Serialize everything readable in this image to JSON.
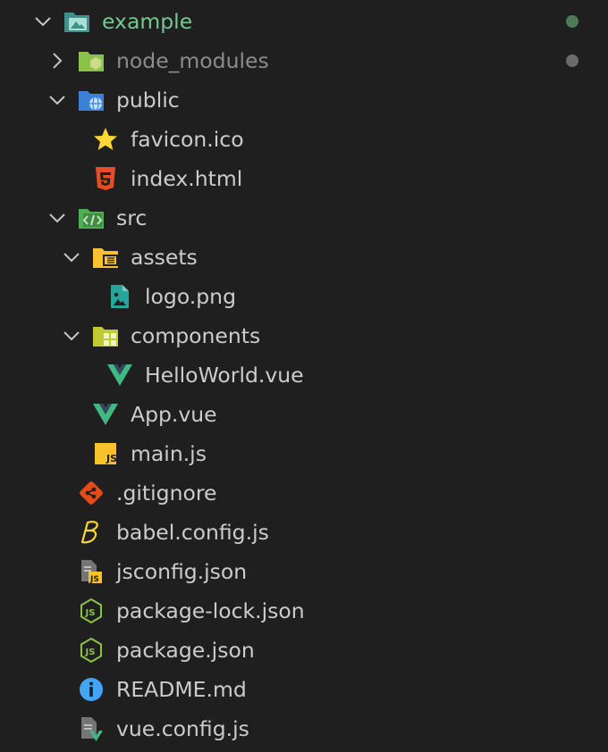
{
  "explorer": {
    "items": [
      {
        "label": "example",
        "icon": "folder-image-icon",
        "expanded": true,
        "color": "#73c991"
      },
      {
        "label": "node_modules",
        "icon": "folder-node-icon",
        "expanded": false,
        "color": "#8c8c8c"
      },
      {
        "label": "public",
        "icon": "folder-public-icon",
        "expanded": true
      },
      {
        "label": "favicon.ico",
        "icon": "star-icon"
      },
      {
        "label": "index.html",
        "icon": "html5-icon"
      },
      {
        "label": "src",
        "icon": "folder-src-icon",
        "expanded": true
      },
      {
        "label": "assets",
        "icon": "folder-assets-icon",
        "expanded": true
      },
      {
        "label": "logo.png",
        "icon": "image-file-icon"
      },
      {
        "label": "components",
        "icon": "folder-components-icon",
        "expanded": true
      },
      {
        "label": "HelloWorld.vue",
        "icon": "vue-icon"
      },
      {
        "label": "App.vue",
        "icon": "vue-icon"
      },
      {
        "label": "main.js",
        "icon": "js-icon"
      },
      {
        "label": ".gitignore",
        "icon": "git-icon"
      },
      {
        "label": "babel.config.js",
        "icon": "babel-icon"
      },
      {
        "label": "jsconfig.json",
        "icon": "jsconfig-icon"
      },
      {
        "label": "package-lock.json",
        "icon": "nodejs-icon"
      },
      {
        "label": "package.json",
        "icon": "nodejs-icon"
      },
      {
        "label": "README.md",
        "icon": "info-icon"
      },
      {
        "label": "vue.config.js",
        "icon": "vue-config-icon"
      }
    ]
  },
  "colors": {
    "background": "#1f1f1f",
    "text": "#cccccc",
    "modified_dot": "#4d7a57",
    "ignored_dot": "#6b6b6b"
  }
}
